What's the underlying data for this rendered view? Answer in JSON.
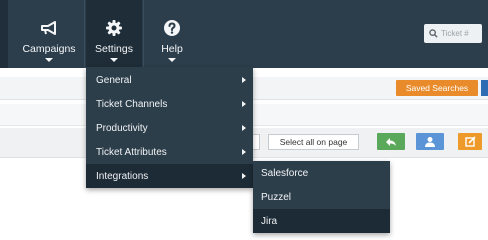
{
  "nav": {
    "items": [
      {
        "label": "Campaigns",
        "icon": "megaphone-icon"
      },
      {
        "label": "Settings",
        "icon": "gear-icon"
      },
      {
        "label": "Help",
        "icon": "help-icon"
      }
    ],
    "search": {
      "placeholder": "Ticket #",
      "icon": "search-icon"
    }
  },
  "toolbar": {
    "saved_searches_label": "Saved Searches",
    "select_all_label": "Select all on page",
    "buttons": [
      {
        "icon": "reply-arrow-icon",
        "color": "#5aa95a"
      },
      {
        "icon": "user-icon",
        "color": "#5b95d8"
      },
      {
        "icon": "edit-icon",
        "color": "#ee9a2a"
      }
    ]
  },
  "settings_menu": {
    "items": [
      {
        "label": "General",
        "has_submenu": true
      },
      {
        "label": "Ticket Channels",
        "has_submenu": true
      },
      {
        "label": "Productivity",
        "has_submenu": true
      },
      {
        "label": "Ticket Attributes",
        "has_submenu": true
      },
      {
        "label": "Integrations",
        "has_submenu": true,
        "active": true
      }
    ]
  },
  "integrations_submenu": {
    "items": [
      {
        "label": "Salesforce"
      },
      {
        "label": "Puzzel"
      },
      {
        "label": "Jira",
        "active": true
      }
    ]
  },
  "colors": {
    "nav_bg": "#2c3e4c",
    "menu_bg": "#2d3e4b",
    "menu_active": "#1d2b36",
    "saved_searches": "#e98b2a"
  }
}
